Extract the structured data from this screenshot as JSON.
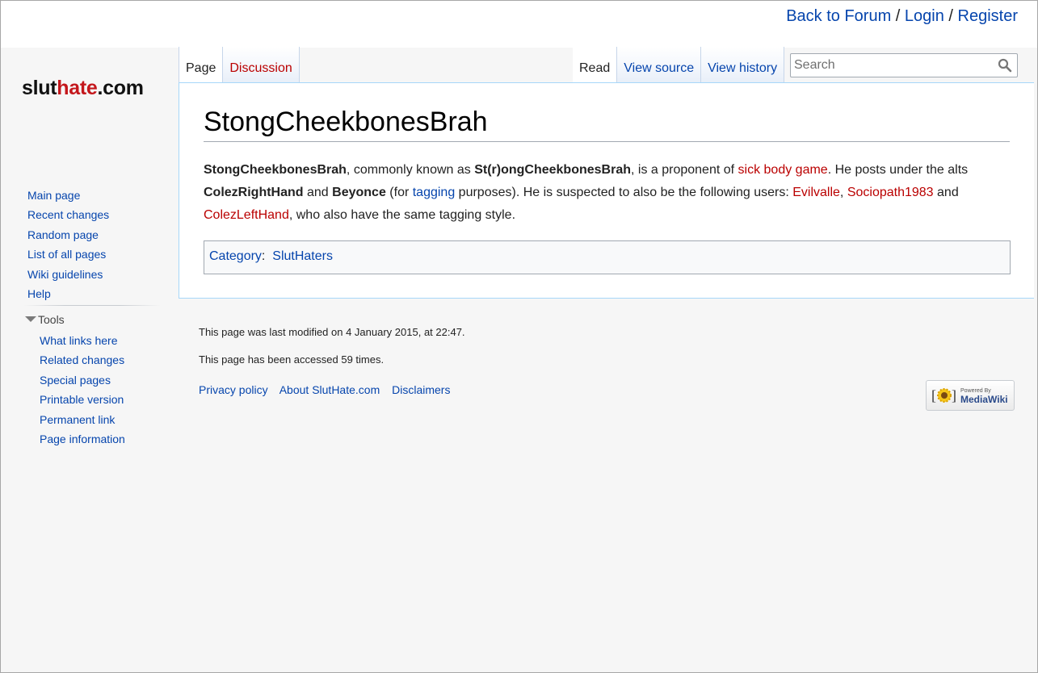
{
  "top_links": {
    "back": "Back to Forum",
    "sep1": " / ",
    "login": "Login",
    "sep2": " / ",
    "register": "Register"
  },
  "logo": {
    "part1": "slut",
    "part2": "hate",
    "part3": ".com"
  },
  "tabs_left": [
    {
      "label": "Page",
      "selected": true
    },
    {
      "label": "Discussion"
    }
  ],
  "tabs_right": [
    {
      "label": "Read",
      "selected": true
    },
    {
      "label": "View source"
    },
    {
      "label": "View history"
    }
  ],
  "search": {
    "placeholder": "Search",
    "icon": "search-icon"
  },
  "content": {
    "title": "StongCheekbonesBrah",
    "body": {
      "t1": "StongCheekbonesBrah",
      "t2": ", commonly known as ",
      "t3": "St(r)ongCheekbonesBrah",
      "t4": ", is a proponent of ",
      "link1": "sick body game",
      "t5": ". He posts under the alts ",
      "t6": "ColezRightHand",
      "t7": " and ",
      "t8": "Beyonce",
      "t9": " (for ",
      "link2": "tagging",
      "t10": " purposes). He is suspected to also be the following users: ",
      "link3": "Evilvalle",
      "t11": ", ",
      "link4": "Sociopath1983",
      "t12": " and ",
      "link5": "ColezLeftHand",
      "t13": ", who also have the same tagging style."
    },
    "category": {
      "label": "Category",
      "colon": ":",
      "value": "SlutHaters"
    }
  },
  "sidebar": {
    "nav": [
      "Main page",
      "Recent changes",
      "Random page",
      "List of all pages",
      "Wiki guidelines",
      "Help"
    ],
    "tools_heading": "Tools",
    "tools": [
      "What links here",
      "Related changes",
      "Special pages",
      "Printable version",
      "Permanent link",
      "Page information"
    ]
  },
  "footer": {
    "modified": "This page was last modified on 4 January 2015, at 22:47.",
    "accessed": "This page has been accessed 59 times.",
    "links": [
      "Privacy policy",
      "About SlutHate.com",
      "Disclaimers"
    ],
    "powered_small": "Powered By",
    "powered_big": "MediaWiki"
  },
  "colors": {
    "link": "#0645ad",
    "redlink": "#ba0000",
    "logo_accent": "#c4171c"
  }
}
